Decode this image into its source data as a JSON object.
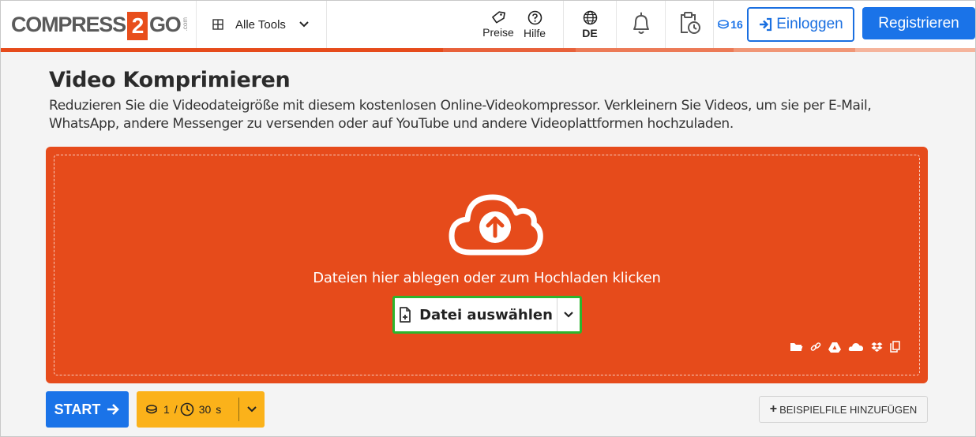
{
  "header": {
    "logo": {
      "part1": "COMPRESS",
      "part2": "2",
      "part3": "GO",
      "suffix": ".com"
    },
    "tools_label": "Alle Tools",
    "prices_label": "Preise",
    "help_label": "Hilfe",
    "language": "DE",
    "credits": "16",
    "login_label": "Einloggen",
    "register_label": "Registrieren"
  },
  "colors": {
    "accent": "#e64b1b",
    "primary": "#1a73e8",
    "warning": "#fbb21a",
    "select_border": "#2db52d"
  },
  "page": {
    "title": "Video Komprimieren",
    "description": "Reduzieren Sie die Videodateigröße mit diesem kostenlosen Online-Videokompressor. Verkleinern Sie Videos, um sie per E-Mail, WhatsApp, andere Messenger zu versenden oder auf YouTube und andere Videoplattformen hochzuladen."
  },
  "upload": {
    "icon": "cloud-upload-icon",
    "drop_text": "Dateien hier ablegen oder zum Hochladen klicken",
    "choose_label": "Datei auswählen",
    "sources": [
      "folder-icon",
      "link-icon",
      "google-drive-icon",
      "onedrive-icon",
      "dropbox-icon",
      "clipboard-icon"
    ]
  },
  "actions": {
    "start_label": "START",
    "credits_cost": "1",
    "separator": "/",
    "time_cost": "30",
    "time_unit": "s",
    "sample_label": "Beispielfile hinzufügen"
  }
}
